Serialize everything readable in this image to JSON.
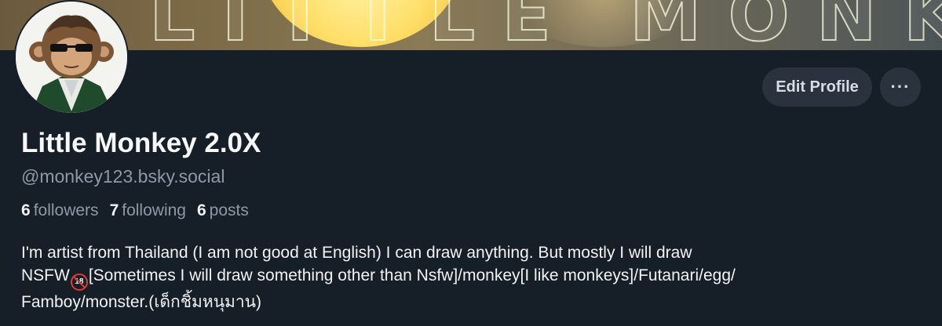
{
  "banner": {
    "text": "LITTLE MONKEY"
  },
  "profile": {
    "display_name": "Little Monkey 2.0X",
    "handle": "@monkey123.bsky.social"
  },
  "actions": {
    "edit_label": "Edit Profile",
    "more_label": "···"
  },
  "stats": {
    "followers_count": "6",
    "followers_label": "followers",
    "following_count": "7",
    "following_label": "following",
    "posts_count": "6",
    "posts_label": "posts"
  },
  "bio": {
    "line1": "I'm artist from Thailand (I am not good at English) I can draw anything. But mostly I will draw",
    "line2_prefix": "NSFW",
    "emoji_18": "18",
    "line2_suffix": "[Sometimes I will draw something other than Nsfw]/monkey[I like monkeys]/Futanari/egg/",
    "line3": "Famboy/monster.(เด็กชิ้มหนุมาน)"
  },
  "colors": {
    "background": "#161e27",
    "button": "#29323d",
    "muted_text": "#8d99a6",
    "primary_text": "#f1f3f5"
  }
}
